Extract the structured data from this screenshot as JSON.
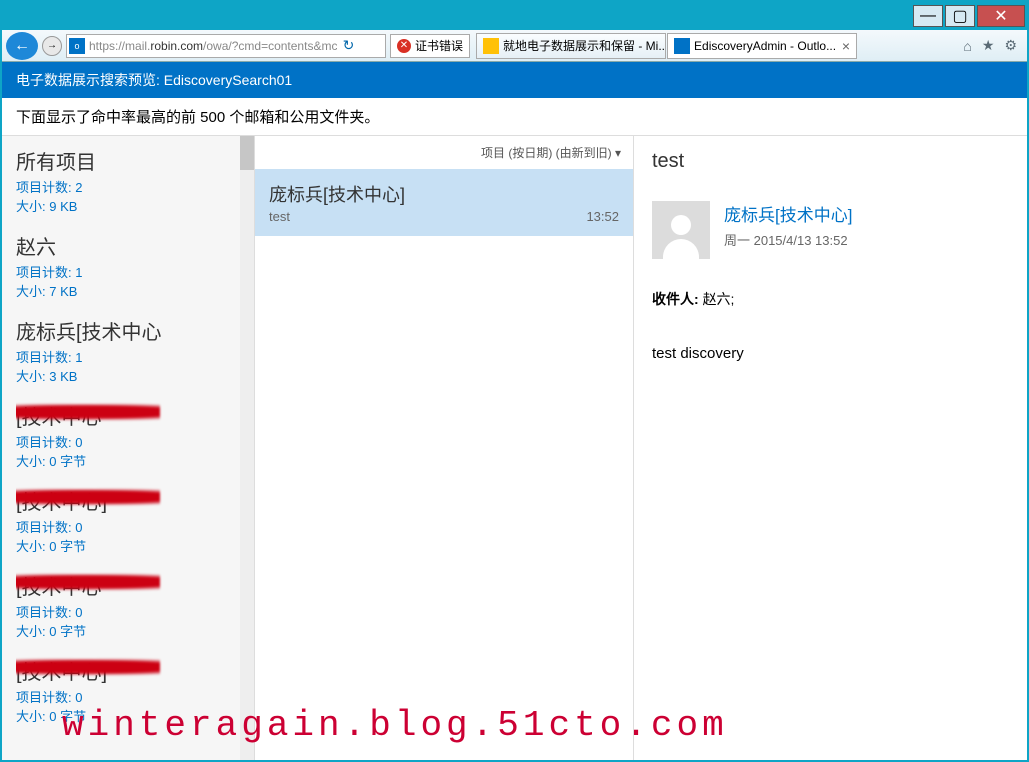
{
  "window": {
    "min": "—",
    "max": "▢",
    "close": "✕"
  },
  "nav": {
    "url_prefix": "https://mail.",
    "url_host": "robin.com",
    "url_path": "/owa/?cmd=contents&mc",
    "refresh": "↻",
    "cert_error": "证书错误"
  },
  "tabs": [
    {
      "label": "就地电子数据展示和保留 - Mi..."
    },
    {
      "label": "EdiscoveryAdmin - Outlo..."
    }
  ],
  "toolbar": {
    "home": "⌂",
    "star": "★",
    "gear": "⚙"
  },
  "header": {
    "title": "电子数据展示搜索预览: EdiscoverySearch01"
  },
  "subheader": "下面显示了命中率最高的前 500 个邮箱和公用文件夹。",
  "mailboxes": [
    {
      "title": "所有项目",
      "count_label": "项目计数:",
      "count": "2",
      "size_label": "大小:",
      "size": "9 KB",
      "redacted": false
    },
    {
      "title": "赵六",
      "count_label": "项目计数:",
      "count": "1",
      "size_label": "大小:",
      "size": "7 KB",
      "redacted": false
    },
    {
      "title": "庞标兵[技术中心",
      "count_label": "项目计数:",
      "count": "1",
      "size_label": "大小:",
      "size": "3 KB",
      "redacted": false
    },
    {
      "title": "[技术中心",
      "count_label": "项目计数:",
      "count": "0",
      "size_label": "大小:",
      "size": "0 字节",
      "redacted": true
    },
    {
      "title": "[技术中心]",
      "count_label": "项目计数:",
      "count": "0",
      "size_label": "大小:",
      "size": "0 字节",
      "redacted": true
    },
    {
      "title": "[技术中心",
      "count_label": "项目计数:",
      "count": "0",
      "size_label": "大小:",
      "size": "0 字节",
      "redacted": true
    },
    {
      "title": "[技术中心]",
      "count_label": "项目计数:",
      "count": "0",
      "size_label": "大小:",
      "size": "0 字节",
      "redacted": true
    }
  ],
  "list": {
    "sort_label": "项目 (按日期) (由新到旧) ▾",
    "items": [
      {
        "from": "庞标兵[技术中心]",
        "subject": "test",
        "time": "13:52"
      }
    ]
  },
  "reading": {
    "subject": "test",
    "from": "庞标兵[技术中心]",
    "date": "周一 2015/4/13 13:52",
    "recipients_label": "收件人:",
    "recipients": "赵六;",
    "body": "test discovery"
  },
  "watermark": "winteragain.blog.51cto.com"
}
